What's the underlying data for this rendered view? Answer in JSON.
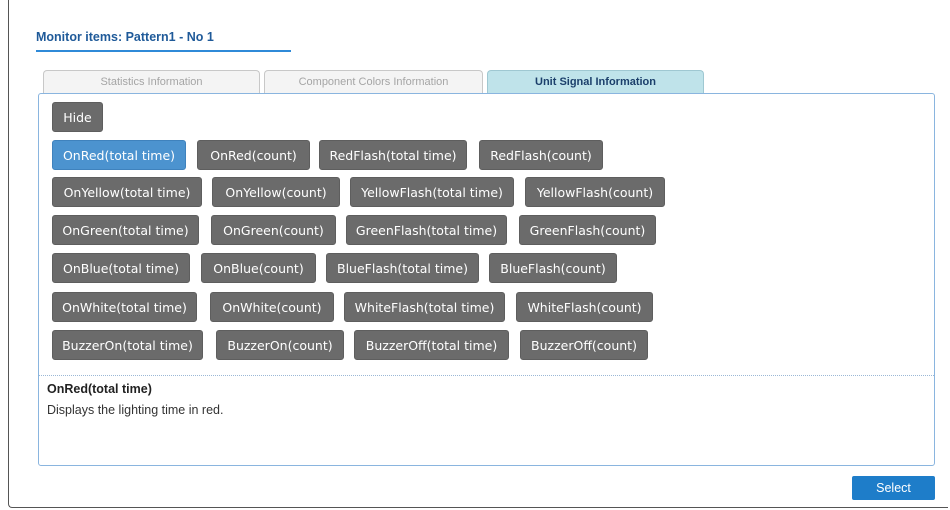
{
  "dialog": {
    "title": "Monitor items: Pattern1 - No 1"
  },
  "tabs": [
    {
      "label": "Statistics Information",
      "active": false
    },
    {
      "label": "Component Colors Information",
      "active": false
    },
    {
      "label": "Unit Signal Information",
      "active": true
    }
  ],
  "hide_button": "Hide",
  "signal_rows": [
    [
      "OnRed(total time)",
      "OnRed(count)",
      "RedFlash(total time)",
      "RedFlash(count)"
    ],
    [
      "OnYellow(total time)",
      "OnYellow(count)",
      "YellowFlash(total time)",
      "YellowFlash(count)"
    ],
    [
      "OnGreen(total time)",
      "OnGreen(count)",
      "GreenFlash(total time)",
      "GreenFlash(count)"
    ],
    [
      "OnBlue(total time)",
      "OnBlue(count)",
      "BlueFlash(total time)",
      "BlueFlash(count)"
    ],
    [
      "OnWhite(total time)",
      "OnWhite(count)",
      "WhiteFlash(total time)",
      "WhiteFlash(count)"
    ],
    [
      "BuzzerOn(total time)",
      "BuzzerOn(count)",
      "BuzzerOff(total time)",
      "BuzzerOff(count)"
    ]
  ],
  "selected_item": "OnRed(total time)",
  "description": {
    "title": "OnRed(total time)",
    "text": "Displays the lighting time in red."
  },
  "select_button": "Select",
  "colors": {
    "button_gray": "#6b6b6b",
    "button_selected": "#4c93cf",
    "primary": "#1e7dc9",
    "active_tab": "#bfe3ea"
  }
}
